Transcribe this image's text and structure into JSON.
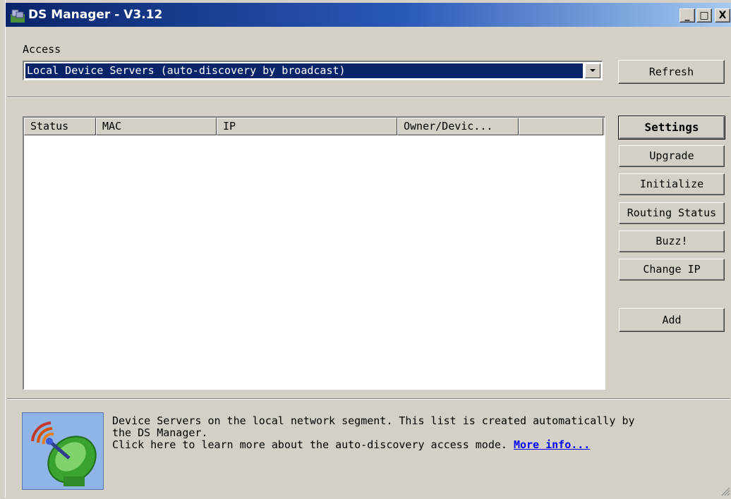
{
  "window": {
    "title": "DS Manager - V3.12",
    "minimize_label": "_",
    "maximize_label": "□",
    "close_label": "X"
  },
  "access": {
    "label": "Access",
    "selected": "Local Device Servers (auto-discovery by broadcast)",
    "refresh_label": "Refresh"
  },
  "table": {
    "columns": [
      "Status",
      "MAC",
      "IP",
      "Owner/Devic...",
      ""
    ],
    "rows": []
  },
  "actions": {
    "settings": "Settings",
    "upgrade": "Upgrade",
    "initialize": "Initialize",
    "routing_status": "Routing Status",
    "buzz": "Buzz!",
    "change_ip": "Change IP",
    "add": "Add"
  },
  "info": {
    "line1": "Device Servers on the local network segment. This list is created automatically by",
    "line2": "the DS Manager.",
    "line3": "Click here to learn more about the auto-discovery access mode.",
    "link": "More info...",
    "icon": "satellite-dish-icon"
  },
  "colors": {
    "face": "#d4d0c8",
    "title_start": "#0a246a",
    "title_end": "#a6caf0",
    "selection": "#0a246a",
    "link": "#0000ff"
  }
}
